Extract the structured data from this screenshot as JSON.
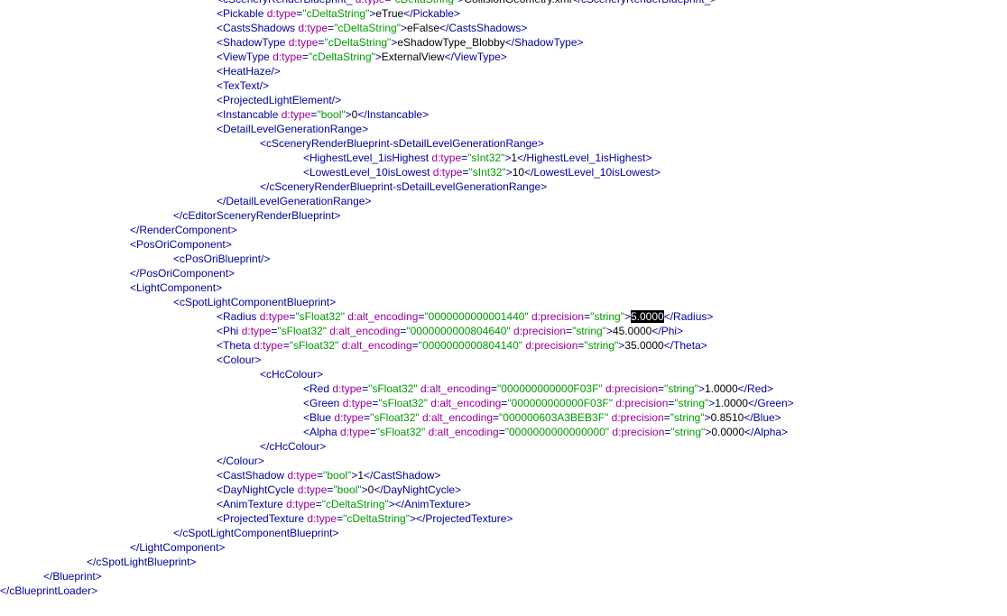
{
  "lines": [
    {
      "level": 5,
      "parts": [
        [
          "tag",
          "<"
        ],
        [
          "tag",
          "cSceneryRenderBlueprint_"
        ],
        [
          "attr",
          " d:type"
        ],
        [
          "attr",
          "="
        ],
        [
          "val",
          "\"cDeltaString\""
        ],
        [
          "tag",
          ">"
        ],
        [
          "text",
          "CollisionGeometry.xml"
        ],
        [
          "tag",
          "</"
        ],
        [
          "tag",
          "cSceneryRenderBlueprint_"
        ],
        [
          "tag",
          ">"
        ]
      ]
    },
    {
      "level": 5,
      "parts": [
        [
          "tag",
          "<Pickable"
        ],
        [
          "attr",
          " d:type"
        ],
        [
          "tag",
          "="
        ],
        [
          "val",
          "\"cDeltaString\""
        ],
        [
          "tag",
          ">"
        ],
        [
          "text",
          "eTrue"
        ],
        [
          "tag",
          "</Pickable>"
        ]
      ]
    },
    {
      "level": 5,
      "parts": [
        [
          "tag",
          "<CastsShadows"
        ],
        [
          "attr",
          " d:type"
        ],
        [
          "tag",
          "="
        ],
        [
          "val",
          "\"cDeltaString\""
        ],
        [
          "tag",
          ">"
        ],
        [
          "text",
          "eFalse"
        ],
        [
          "tag",
          "</CastsShadows>"
        ]
      ]
    },
    {
      "level": 5,
      "parts": [
        [
          "tag",
          "<ShadowType"
        ],
        [
          "attr",
          " d:type"
        ],
        [
          "tag",
          "="
        ],
        [
          "val",
          "\"cDeltaString\""
        ],
        [
          "tag",
          ">"
        ],
        [
          "text",
          "eShadowType_Blobby"
        ],
        [
          "tag",
          "</ShadowType>"
        ]
      ]
    },
    {
      "level": 5,
      "parts": [
        [
          "tag",
          "<ViewType"
        ],
        [
          "attr",
          " d:type"
        ],
        [
          "tag",
          "="
        ],
        [
          "val",
          "\"cDeltaString\""
        ],
        [
          "tag",
          ">"
        ],
        [
          "text",
          "ExternalView"
        ],
        [
          "tag",
          "</ViewType>"
        ]
      ]
    },
    {
      "level": 5,
      "parts": [
        [
          "tag",
          "<HeatHaze/>"
        ]
      ]
    },
    {
      "level": 5,
      "parts": [
        [
          "tag",
          "<TexText/>"
        ]
      ]
    },
    {
      "level": 5,
      "parts": [
        [
          "tag",
          "<ProjectedLightElement/>"
        ]
      ]
    },
    {
      "level": 5,
      "parts": [
        [
          "tag",
          "<Instancable"
        ],
        [
          "attr",
          " d:type"
        ],
        [
          "tag",
          "="
        ],
        [
          "val",
          "\"bool\""
        ],
        [
          "tag",
          ">"
        ],
        [
          "text",
          "0"
        ],
        [
          "tag",
          "</Instancable>"
        ]
      ]
    },
    {
      "level": 5,
      "parts": [
        [
          "tag",
          "<DetailLevelGenerationRange>"
        ]
      ]
    },
    {
      "level": 6,
      "parts": [
        [
          "tag",
          "<cSceneryRenderBlueprint-sDetailLevelGenerationRange>"
        ]
      ]
    },
    {
      "level": 7,
      "parts": [
        [
          "tag",
          "<HighestLevel_1isHighest"
        ],
        [
          "attr",
          " d:type"
        ],
        [
          "tag",
          "="
        ],
        [
          "val",
          "\"sInt32\""
        ],
        [
          "tag",
          ">"
        ],
        [
          "text",
          "1"
        ],
        [
          "tag",
          "</HighestLevel_1isHighest>"
        ]
      ]
    },
    {
      "level": 7,
      "parts": [
        [
          "tag",
          "<LowestLevel_10isLowest"
        ],
        [
          "attr",
          " d:type"
        ],
        [
          "tag",
          "="
        ],
        [
          "val",
          "\"sInt32\""
        ],
        [
          "tag",
          ">"
        ],
        [
          "text",
          "10"
        ],
        [
          "tag",
          "</LowestLevel_10isLowest>"
        ]
      ]
    },
    {
      "level": 6,
      "parts": [
        [
          "tag",
          "</cSceneryRenderBlueprint-sDetailLevelGenerationRange>"
        ]
      ]
    },
    {
      "level": 5,
      "parts": [
        [
          "tag",
          "</DetailLevelGenerationRange>"
        ]
      ]
    },
    {
      "level": 4,
      "parts": [
        [
          "tag",
          "</cEditorSceneryRenderBlueprint>"
        ]
      ]
    },
    {
      "level": 3,
      "parts": [
        [
          "tag",
          "</RenderComponent>"
        ]
      ]
    },
    {
      "level": 3,
      "parts": [
        [
          "tag",
          "<PosOriComponent>"
        ]
      ]
    },
    {
      "level": 4,
      "parts": [
        [
          "tag",
          "<cPosOriBlueprint/>"
        ]
      ]
    },
    {
      "level": 3,
      "parts": [
        [
          "tag",
          "</PosOriComponent>"
        ]
      ]
    },
    {
      "level": 3,
      "parts": [
        [
          "tag",
          "<LightComponent>"
        ]
      ]
    },
    {
      "level": 4,
      "parts": [
        [
          "tag",
          "<cSpotLightComponentBlueprint>"
        ]
      ]
    },
    {
      "level": 5,
      "parts": [
        [
          "tag",
          "<Radius"
        ],
        [
          "attr",
          " d:type"
        ],
        [
          "tag",
          "="
        ],
        [
          "val",
          "\"sFloat32\""
        ],
        [
          "attr",
          " d:alt_encoding"
        ],
        [
          "tag",
          "="
        ],
        [
          "val",
          "\"0000000000001440\""
        ],
        [
          "attr",
          " d:precision"
        ],
        [
          "tag",
          "="
        ],
        [
          "val",
          "\"string\""
        ],
        [
          "tag",
          ">"
        ],
        [
          "sel",
          "5.0000"
        ],
        [
          "tag",
          "</Radius>"
        ]
      ]
    },
    {
      "level": 5,
      "parts": [
        [
          "tag",
          "<Phi"
        ],
        [
          "attr",
          " d:type"
        ],
        [
          "tag",
          "="
        ],
        [
          "val",
          "\"sFloat32\""
        ],
        [
          "attr",
          " d:alt_encoding"
        ],
        [
          "tag",
          "="
        ],
        [
          "val",
          "\"0000000000804640\""
        ],
        [
          "attr",
          " d:precision"
        ],
        [
          "tag",
          "="
        ],
        [
          "val",
          "\"string\""
        ],
        [
          "tag",
          ">"
        ],
        [
          "text",
          "45.0000"
        ],
        [
          "tag",
          "</Phi>"
        ]
      ]
    },
    {
      "level": 5,
      "parts": [
        [
          "tag",
          "<Theta"
        ],
        [
          "attr",
          " d:type"
        ],
        [
          "tag",
          "="
        ],
        [
          "val",
          "\"sFloat32\""
        ],
        [
          "attr",
          " d:alt_encoding"
        ],
        [
          "tag",
          "="
        ],
        [
          "val",
          "\"0000000000804140\""
        ],
        [
          "attr",
          " d:precision"
        ],
        [
          "tag",
          "="
        ],
        [
          "val",
          "\"string\""
        ],
        [
          "tag",
          ">"
        ],
        [
          "text",
          "35.0000"
        ],
        [
          "tag",
          "</Theta>"
        ]
      ]
    },
    {
      "level": 5,
      "parts": [
        [
          "tag",
          "<Colour>"
        ]
      ]
    },
    {
      "level": 6,
      "parts": [
        [
          "tag",
          "<cHcColour>"
        ]
      ]
    },
    {
      "level": 7,
      "parts": [
        [
          "tag",
          "<Red"
        ],
        [
          "attr",
          " d:type"
        ],
        [
          "tag",
          "="
        ],
        [
          "val",
          "\"sFloat32\""
        ],
        [
          "attr",
          " d:alt_encoding"
        ],
        [
          "tag",
          "="
        ],
        [
          "val",
          "\"000000000000F03F\""
        ],
        [
          "attr",
          " d:precision"
        ],
        [
          "tag",
          "="
        ],
        [
          "val",
          "\"string\""
        ],
        [
          "tag",
          ">"
        ],
        [
          "text",
          "1.0000"
        ],
        [
          "tag",
          "</Red>"
        ]
      ]
    },
    {
      "level": 7,
      "parts": [
        [
          "tag",
          "<Green"
        ],
        [
          "attr",
          " d:type"
        ],
        [
          "tag",
          "="
        ],
        [
          "val",
          "\"sFloat32\""
        ],
        [
          "attr",
          " d:alt_encoding"
        ],
        [
          "tag",
          "="
        ],
        [
          "val",
          "\"000000000000F03F\""
        ],
        [
          "attr",
          " d:precision"
        ],
        [
          "tag",
          "="
        ],
        [
          "val",
          "\"string\""
        ],
        [
          "tag",
          ">"
        ],
        [
          "text",
          "1.0000"
        ],
        [
          "tag",
          "</Green>"
        ]
      ]
    },
    {
      "level": 7,
      "parts": [
        [
          "tag",
          "<Blue"
        ],
        [
          "attr",
          " d:type"
        ],
        [
          "tag",
          "="
        ],
        [
          "val",
          "\"sFloat32\""
        ],
        [
          "attr",
          " d:alt_encoding"
        ],
        [
          "tag",
          "="
        ],
        [
          "val",
          "\"000000603A3BEB3F\""
        ],
        [
          "attr",
          " d:precision"
        ],
        [
          "tag",
          "="
        ],
        [
          "val",
          "\"string\""
        ],
        [
          "tag",
          ">"
        ],
        [
          "text",
          "0.8510"
        ],
        [
          "tag",
          "</Blue>"
        ]
      ]
    },
    {
      "level": 7,
      "parts": [
        [
          "tag",
          "<Alpha"
        ],
        [
          "attr",
          " d:type"
        ],
        [
          "tag",
          "="
        ],
        [
          "val",
          "\"sFloat32\""
        ],
        [
          "attr",
          " d:alt_encoding"
        ],
        [
          "tag",
          "="
        ],
        [
          "val",
          "\"0000000000000000\""
        ],
        [
          "attr",
          " d:precision"
        ],
        [
          "tag",
          "="
        ],
        [
          "val",
          "\"string\""
        ],
        [
          "tag",
          ">"
        ],
        [
          "text",
          "0.0000"
        ],
        [
          "tag",
          "</Alpha>"
        ]
      ]
    },
    {
      "level": 6,
      "parts": [
        [
          "tag",
          "</cHcColour>"
        ]
      ]
    },
    {
      "level": 5,
      "parts": [
        [
          "tag",
          "</Colour>"
        ]
      ]
    },
    {
      "level": 5,
      "parts": [
        [
          "tag",
          "<CastShadow"
        ],
        [
          "attr",
          " d:type"
        ],
        [
          "tag",
          "="
        ],
        [
          "val",
          "\"bool\""
        ],
        [
          "tag",
          ">"
        ],
        [
          "text",
          "1"
        ],
        [
          "tag",
          "</CastShadow>"
        ]
      ]
    },
    {
      "level": 5,
      "parts": [
        [
          "tag",
          "<DayNightCycle"
        ],
        [
          "attr",
          " d:type"
        ],
        [
          "tag",
          "="
        ],
        [
          "val",
          "\"bool\""
        ],
        [
          "tag",
          ">"
        ],
        [
          "text",
          "0"
        ],
        [
          "tag",
          "</DayNightCycle>"
        ]
      ]
    },
    {
      "level": 5,
      "parts": [
        [
          "tag",
          "<AnimTexture"
        ],
        [
          "attr",
          " d:type"
        ],
        [
          "tag",
          "="
        ],
        [
          "val",
          "\"cDeltaString\""
        ],
        [
          "tag",
          "></AnimTexture>"
        ]
      ]
    },
    {
      "level": 5,
      "parts": [
        [
          "tag",
          "<ProjectedTexture"
        ],
        [
          "attr",
          " d:type"
        ],
        [
          "tag",
          "="
        ],
        [
          "val",
          "\"cDeltaString\""
        ],
        [
          "tag",
          "></ProjectedTexture>"
        ]
      ]
    },
    {
      "level": 4,
      "parts": [
        [
          "tag",
          "</cSpotLightComponentBlueprint>"
        ]
      ]
    },
    {
      "level": 3,
      "parts": [
        [
          "tag",
          "</LightComponent>"
        ]
      ]
    },
    {
      "level": 2,
      "parts": [
        [
          "tag",
          "</cSpotLightBlueprint>"
        ]
      ]
    },
    {
      "level": 1,
      "parts": [
        [
          "tag",
          "</Blueprint>"
        ]
      ]
    },
    {
      "level": 0,
      "parts": [
        [
          "tag",
          "</cBlueprintLoader>"
        ]
      ]
    }
  ],
  "colors": {
    "tag": "#000099",
    "attr": "#990099",
    "value": "#009900",
    "text": "#000000",
    "selection_bg": "#000000",
    "selection_fg": "#ffffff"
  }
}
